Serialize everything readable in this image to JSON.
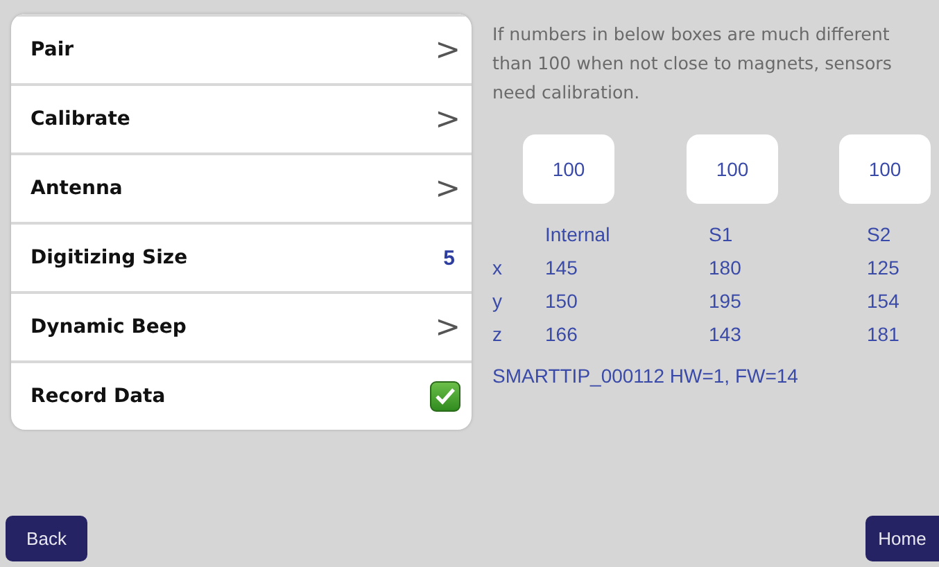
{
  "menu": [
    {
      "label": "Pair",
      "kind": "arrow",
      "indicator": ">"
    },
    {
      "label": "Calibrate",
      "kind": "arrow",
      "indicator": ">"
    },
    {
      "label": "Antenna",
      "kind": "arrow",
      "indicator": ">"
    },
    {
      "label": "Digitizing Size",
      "kind": "value",
      "value": "5"
    },
    {
      "label": "Dynamic Beep",
      "kind": "arrow",
      "indicator": ">"
    },
    {
      "label": "Record Data",
      "kind": "checkbox",
      "checked": true
    }
  ],
  "hint": "If numbers in below boxes are much different than 100 when not close to magnets, sensors need calibration.",
  "boxes": [
    "100",
    "100",
    "100"
  ],
  "table": {
    "columns": [
      "Internal",
      "S1",
      "S2"
    ],
    "rows": [
      {
        "axis": "x",
        "values": [
          "145",
          "180",
          "125"
        ]
      },
      {
        "axis": "y",
        "values": [
          "150",
          "195",
          "154"
        ]
      },
      {
        "axis": "z",
        "values": [
          "166",
          "143",
          "181"
        ]
      }
    ]
  },
  "device_info": "SMARTTIP_000112 HW=1, FW=14",
  "buttons": {
    "back": "Back",
    "home": "Home"
  }
}
